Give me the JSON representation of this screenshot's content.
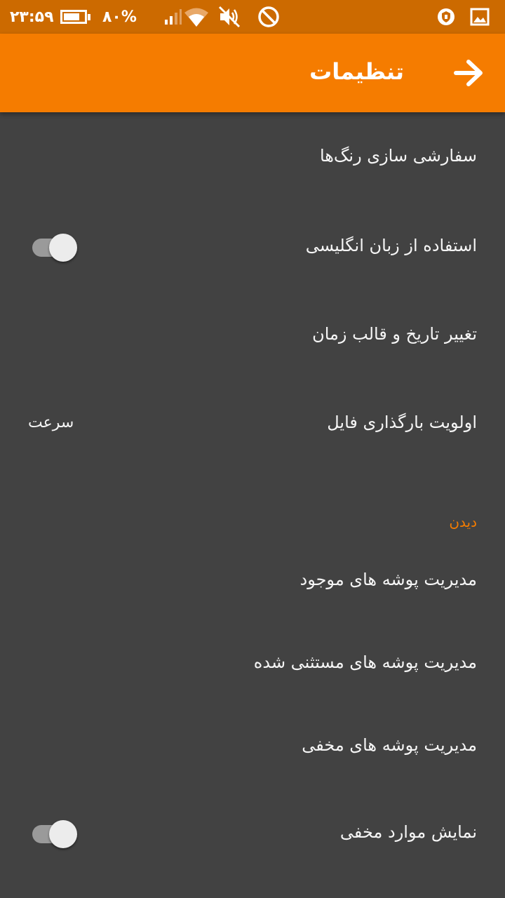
{
  "status_bar": {
    "time": "۲۳:۵۹",
    "battery_percent": "۸۰%",
    "battery_level": 0.8,
    "icons": [
      "battery-icon",
      "signal-icon",
      "wifi-icon",
      "mute-icon",
      "do-not-disturb-icon",
      "vpn-shield-icon",
      "gallery-icon"
    ]
  },
  "toolbar": {
    "title": "تنظیمات",
    "back_icon": "arrow-right-icon",
    "color": "#f57c00"
  },
  "settings": {
    "customize_colors": {
      "label": "سفارشی سازی رنگ‌ها"
    },
    "use_english": {
      "label": "استفاده از زبان انگلیسی",
      "enabled": false
    },
    "date_time_format": {
      "label": "تغییر تاریخ و قالب زمان"
    },
    "file_loading_priority": {
      "label": "اولویت بارگذاری فایل",
      "value": "سرعت"
    },
    "section_view": {
      "title": "دیدن",
      "color": "#f57c00"
    },
    "manage_included_folders": {
      "label": "مدیریت پوشه های موجود"
    },
    "manage_excluded_folders": {
      "label": "مدیریت پوشه های مستثنی شده"
    },
    "manage_hidden_folders": {
      "label": "مدیریت پوشه های مخفی"
    },
    "show_hidden_items": {
      "label": "نمایش موارد مخفی",
      "enabled": false
    }
  },
  "colors": {
    "status_bar": "#cc6a00",
    "background": "#424242",
    "text": "#f5f5f5"
  }
}
